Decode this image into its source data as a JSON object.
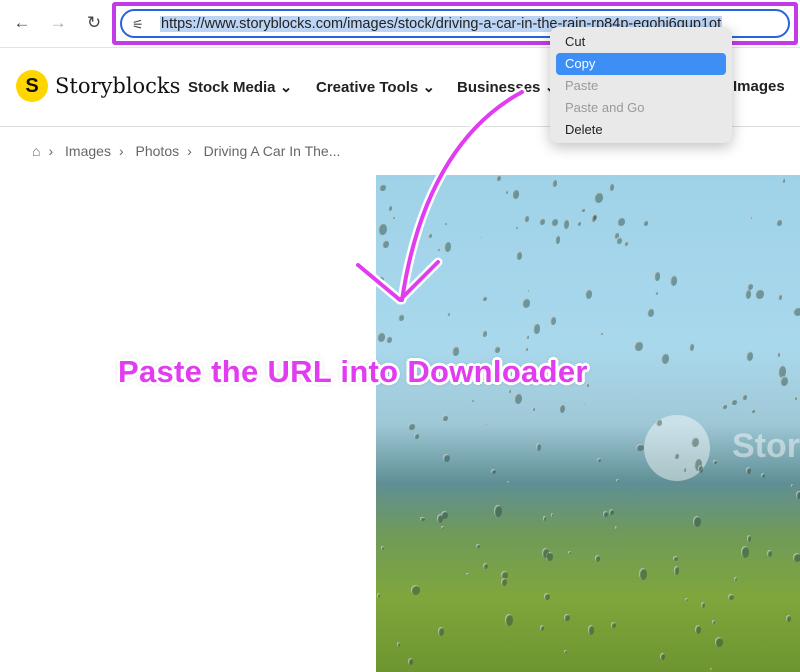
{
  "browser": {
    "back": "←",
    "forward": "→",
    "reload": "↻",
    "url": "https://www.storyblocks.com/images/stock/driving-a-car-in-the-rain-rp84p-eqohi6qup1ot"
  },
  "site": {
    "logo_letter": "S",
    "brand": "Storyblocks",
    "menu": [
      "Stock Media",
      "Creative Tools",
      "Businesses",
      "Images"
    ]
  },
  "breadcrumb": [
    "Images",
    "Photos",
    "Driving A Car In The..."
  ],
  "context_menu": {
    "items": [
      {
        "label": "Cut",
        "state": "normal"
      },
      {
        "label": "Copy",
        "state": "selected"
      },
      {
        "label": "Paste",
        "state": "disabled"
      },
      {
        "label": "Paste and Go",
        "state": "disabled"
      },
      {
        "label": "Delete",
        "state": "normal"
      }
    ]
  },
  "photo": {
    "watermark": "Stor"
  },
  "annotation": {
    "text": "Paste the URL into Downloader",
    "color": "#e23cf0"
  }
}
